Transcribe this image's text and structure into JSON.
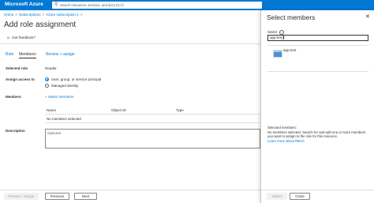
{
  "topbar": {
    "brand": "Microsoft Azure",
    "search_placeholder": "Search resources, services, and docs (G+/)"
  },
  "breadcrumbs": [
    "Home",
    "Subscriptions",
    "Azure subscription 1"
  ],
  "page_title": "Add role assignment",
  "feedback_label": "Got feedback?",
  "tabs": [
    {
      "label": "Role"
    },
    {
      "label": "Members",
      "dot": "*"
    },
    {
      "label": "Review + assign"
    }
  ],
  "form": {
    "selected_role_label": "Selected role",
    "selected_role_value": "Reader",
    "assign_access_label": "Assign access to",
    "options": [
      "User, group, or service principal",
      "Managed identity"
    ],
    "members_label": "Members",
    "select_members_link": "+ Select members",
    "table_headers": [
      "Name",
      "Object ID",
      "Type"
    ],
    "no_members_text": "No members selected",
    "description_label": "Description",
    "description_placeholder": "Optional"
  },
  "footer": {
    "review_assign": "Review + assign",
    "previous": "Previous",
    "next": "Next"
  },
  "panel": {
    "title": "Select members",
    "select_label": "Select",
    "search_value": "app-test",
    "results": [
      {
        "name": "app-test"
      }
    ],
    "selected_members_title": "Selected members:",
    "selected_members_text": "No members selected. Search for and add one or more members you want to assign to the role for this resource.",
    "learn_more": "Learn more about RBAC",
    "select_button": "Select",
    "close_button": "Close"
  },
  "colors": {
    "accent": "#0078d4",
    "text": "#323130",
    "border": "#e1dfdd"
  }
}
